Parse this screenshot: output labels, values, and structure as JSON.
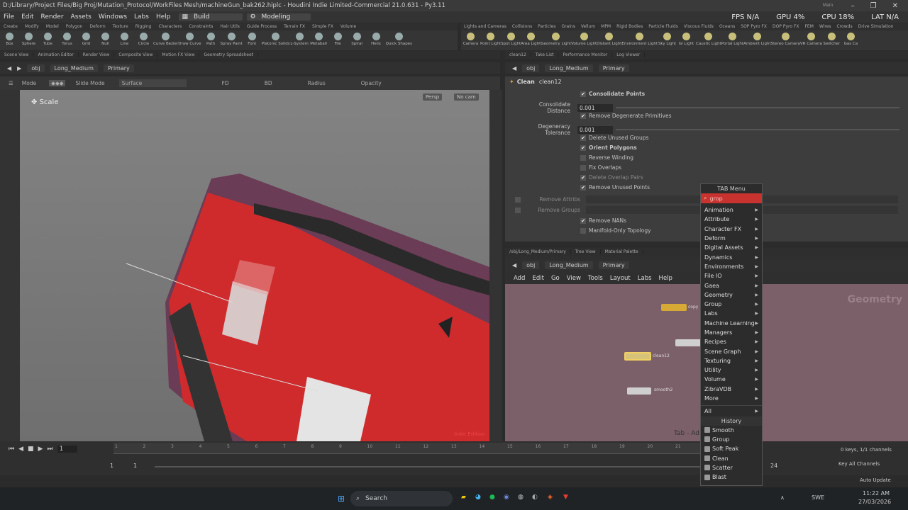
{
  "window": {
    "title": "D:/Library/Project Files/Big Proj/Mutation_Protocol/WorkFiles Mesh/machineGun_bak262.hiplc - Houdini Indie Limited-Commercial 21.0.631 - Py3.11",
    "overlay": "Main"
  },
  "menubar": {
    "items": [
      "File",
      "Edit",
      "Render",
      "Assets",
      "Windows",
      "Labs",
      "Help"
    ],
    "desktop1": "Build",
    "desktop2": "Modeling",
    "stats": {
      "fps": "FPS N/A",
      "gpu": "GPU 4%",
      "cpu": "CPU 18%",
      "lat": "LAT N/A"
    }
  },
  "shelf_tabs_left": [
    "Create",
    "Modify",
    "Model",
    "Polygon",
    "Deform",
    "Texture",
    "Rigging",
    "Characters",
    "Constraints",
    "Hair Utils",
    "Guide Process",
    "Terrain FX",
    "Simple FX",
    "Volume"
  ],
  "shelf_tabs_right": [
    "Lights and Cameras",
    "Collisions",
    "Particles",
    "Grains",
    "Vellum",
    "MPM",
    "Rigid Bodies",
    "Particle Fluids",
    "Viscous Fluids",
    "Oceans",
    "SOP Pyro FX",
    "DOP Pyro FX",
    "FEM",
    "Wires",
    "Crowds",
    "Drive Simulation"
  ],
  "shelf_tools_left": [
    "Box",
    "Sphere",
    "Tube",
    "Torus",
    "Grid",
    "Null",
    "Line",
    "Circle",
    "Curve Bezier",
    "Draw Curve",
    "Path",
    "Spray Paint",
    "Font",
    "Platonic Solids",
    "L-System",
    "Metaball",
    "File",
    "Spiral",
    "Helix",
    "Quick Shapes"
  ],
  "shelf_tools_right": [
    "Camera",
    "Point Light",
    "Spot Light",
    "Area Light",
    "Geometry Light",
    "Volume Light",
    "Distant Light",
    "Environment Light",
    "Sky Light",
    "GI Light",
    "Caustic Light",
    "Portal Light",
    "Ambient Light",
    "Stereo Camera",
    "VR Camera",
    "Switcher",
    "Gas Ca"
  ],
  "left_pane_tabs": [
    "Scene View",
    "Animation Editor",
    "Render View",
    "Composite View",
    "Motion FX View",
    "Geometry Spreadsheet"
  ],
  "right_pane_tabs": [
    "clean12",
    "Take List",
    "Performance Monitor",
    "Log Viewer"
  ],
  "path": {
    "root": "obj",
    "object": "Long_Medium",
    "context": "Primary"
  },
  "viewport": {
    "mode_label": "Mode",
    "slide_mode": "Slide Mode",
    "surface": "Surface",
    "fd": "FD",
    "bd": "BD",
    "radius": "Radius",
    "opacity": "Opacity",
    "tool_name": "Scale",
    "persp": "Persp",
    "cam": "No cam",
    "edition": "Indie Edition"
  },
  "params": {
    "node_type": "Clean",
    "node_name": "clean12",
    "consolidate_points": "Consolidate Points",
    "consolidate_distance_label": "Consolidate Distance",
    "consolidate_distance": "0.001",
    "remove_degenerate": "Remove Degenerate Primitives",
    "degeneracy_label": "Degeneracy Tolerance",
    "degeneracy": "0.001",
    "delete_unused_groups": "Delete Unused Groups",
    "orient_polygons": "Orient Polygons",
    "reverse_winding": "Reverse Winding",
    "fix_overlaps": "Fix Overlaps",
    "delete_overlap_pairs": "Delete Overlap Pairs",
    "remove_unused_points": "Remove Unused Points",
    "remove_attribs": "Remove Attribs",
    "remove_groups": "Remove Groups",
    "remove_nans": "Remove NANs",
    "manifold_only": "Manifold-Only Topology"
  },
  "network": {
    "tabs": [
      "/obj/Long_Medium/Primary",
      "Tree View",
      "Material Palette"
    ],
    "menu": [
      "Add",
      "Edit",
      "Go",
      "View",
      "Tools",
      "Layout",
      "Labs",
      "Help"
    ],
    "context_label": "Geometry",
    "nodes": [
      "copy",
      "clean12",
      "smooth2"
    ],
    "tab_hint": "Tab - Ad"
  },
  "tab_menu": {
    "title": "TAB Menu",
    "search": "grop",
    "categories": [
      "Animation",
      "Attribute",
      "Character FX",
      "Deform",
      "Digital Assets",
      "Dynamics",
      "Environments",
      "File IO",
      "Gaea",
      "Geometry",
      "Group",
      "Labs",
      "Machine Learning",
      "Managers",
      "Recipes",
      "Scene Graph",
      "Texturing",
      "Utility",
      "Volume",
      "ZibraVDB",
      "More"
    ],
    "all": "All",
    "history_title": "History",
    "history": [
      "Smooth",
      "Group",
      "Soft Peak",
      "Clean",
      "Scatter",
      "Blast"
    ]
  },
  "timeline": {
    "frame": "1",
    "start": "1",
    "start2": "1",
    "ticks": [
      "1",
      "2",
      "3",
      "4",
      "5",
      "6",
      "7",
      "8",
      "9",
      "10",
      "11",
      "12",
      "13",
      "14",
      "15",
      "16",
      "17",
      "18",
      "19",
      "20",
      "21"
    ],
    "end_frame": "24",
    "keys": "0 keys, 1/1 channels",
    "key_all": "Key All Channels",
    "auto_update": "Auto Update"
  },
  "taskbar": {
    "search": "Search",
    "lang": "SWE",
    "time": "11:22 AM",
    "date": "27/03/2026"
  },
  "colors": {
    "accent": "#c8332f",
    "mesh_red": "#cf2b2d",
    "mesh_purple": "#6b3c55",
    "network_bg": "#7c6069"
  }
}
